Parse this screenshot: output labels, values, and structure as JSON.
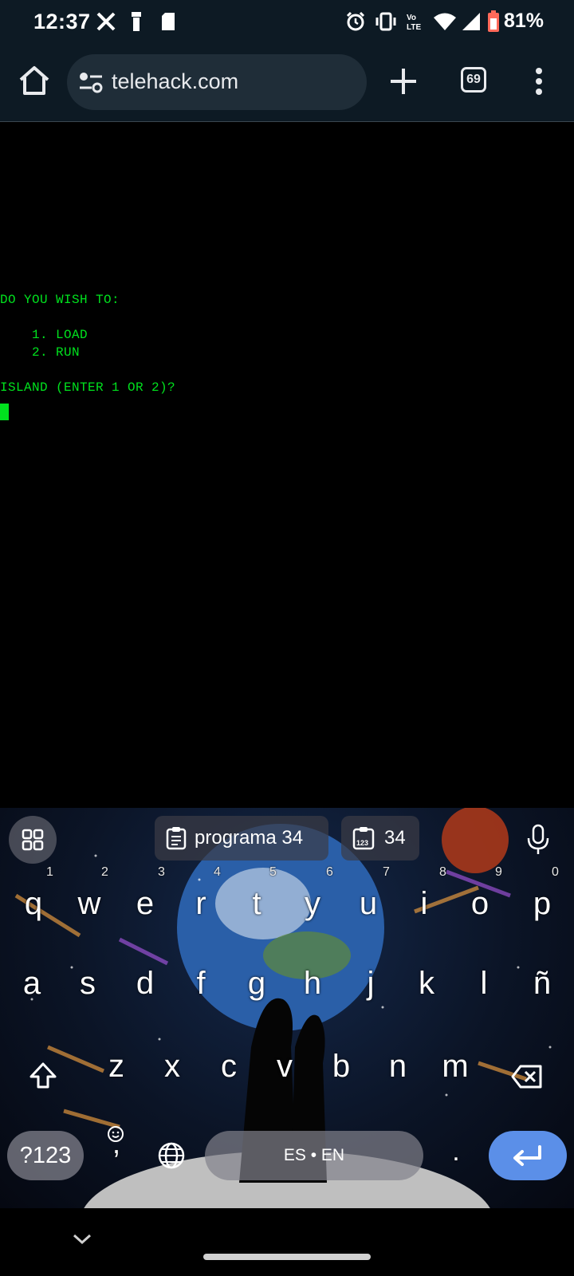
{
  "status_bar": {
    "time": "12:37",
    "battery": "81%",
    "left_icons": [
      "x-icon",
      "flashlight-icon",
      "sd-card-icon"
    ],
    "right_icons": [
      "alarm-icon",
      "vibrate-icon",
      "volte-icon",
      "wifi-icon",
      "signal-icon",
      "battery-icon"
    ]
  },
  "browser": {
    "url": "telehack.com",
    "tab_count": "69"
  },
  "terminal": {
    "lines": [
      "DO YOU WISH TO:",
      "",
      "    1. LOAD",
      "    2. RUN",
      "",
      "ISLAND (ENTER 1 OR 2)?"
    ],
    "text_color": "#00e21e"
  },
  "keyboard": {
    "suggestions": [
      {
        "text": "programa 34",
        "icon": "clipboard-icon"
      },
      {
        "text": "34",
        "icon": "clipboard-number-icon"
      }
    ],
    "row1": [
      "q",
      "w",
      "e",
      "r",
      "t",
      "y",
      "u",
      "i",
      "o",
      "p"
    ],
    "row1_numbers": [
      "1",
      "2",
      "3",
      "4",
      "5",
      "6",
      "7",
      "8",
      "9",
      "0"
    ],
    "row2": [
      "a",
      "s",
      "d",
      "f",
      "g",
      "h",
      "j",
      "k",
      "l",
      "ñ"
    ],
    "row3": [
      "z",
      "x",
      "c",
      "v",
      "b",
      "n",
      "m"
    ],
    "symbols_label": "?123",
    "comma": ",",
    "space_label": "ES • EN",
    "period": ".",
    "enter_color": "#5b8fe8"
  }
}
